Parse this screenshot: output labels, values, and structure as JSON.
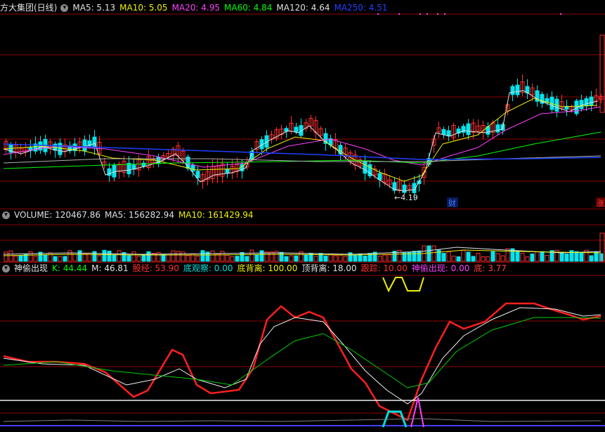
{
  "price_header": {
    "title": "方大集团(日线)",
    "items": [
      {
        "label": "MA5: 5.13",
        "color": "#e0e0e0"
      },
      {
        "label": "MA10: 5.05",
        "color": "#f0f000"
      },
      {
        "label": "MA20: 4.95",
        "color": "#ff40ff"
      },
      {
        "label": "MA60: 4.84",
        "color": "#00ff00"
      },
      {
        "label": "MA120: 4.64",
        "color": "#e0e0e0"
      },
      {
        "label": "MA250: 4.51",
        "color": "#2040ff"
      }
    ]
  },
  "price_panel": {
    "low_label": "←4.19",
    "markers": [
      {
        "text": "财",
        "color": "#3a7bff"
      },
      {
        "text": "涨",
        "color": "#ff4040"
      }
    ]
  },
  "volume_header": {
    "items": [
      {
        "label": "VOLUME: 120467.86",
        "color": "#e0e0e0"
      },
      {
        "label": "MA5: 156282.94",
        "color": "#e0e0e0"
      },
      {
        "label": "MA10: 161429.94",
        "color": "#f0f000"
      }
    ]
  },
  "indicator_header": {
    "name": "神偷出现",
    "items": [
      {
        "label": "K: 44.44",
        "color": "#00ff00"
      },
      {
        "label": "M: 46.81",
        "color": "#e0e0e0"
      },
      {
        "label": "股经: 53.90",
        "color": "#ff3030"
      },
      {
        "label": "底观察: 0.00",
        "color": "#00e0e0"
      },
      {
        "label": "底背离: 100.00",
        "color": "#f0f000"
      },
      {
        "label": "顶背离: 18.00",
        "color": "#e0e0e0"
      },
      {
        "label": "跟踪: 10.00",
        "color": "#ff3030"
      },
      {
        "label": "神偷出现: 0.00",
        "color": "#ff40ff"
      },
      {
        "label": "底: 3.77",
        "color": "#ff4040"
      }
    ]
  },
  "colors": {
    "up": "#ff3030",
    "down": "#00e5ee",
    "grid": "#8b0000"
  }
}
